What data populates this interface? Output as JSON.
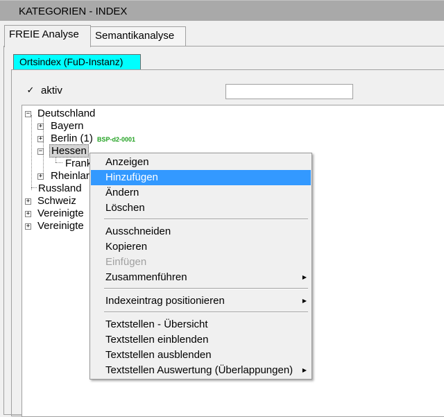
{
  "window": {
    "title": "KATEGORIEN - INDEX"
  },
  "tabs": [
    {
      "label": "FREIE Analyse",
      "active": true
    },
    {
      "label": "Semantikanalyse",
      "active": false
    }
  ],
  "subtab": {
    "label": "Ortsindex (FuD-Instanz)"
  },
  "filter": {
    "active_label": "aktiv",
    "checked": true,
    "checkmark": "✓",
    "input_value": ""
  },
  "tree": {
    "root": "Deutschland",
    "children": [
      {
        "label": "Bayern"
      },
      {
        "label": "Berlin (1)",
        "code": "BSP-d2-0001",
        "code_color": "#21a121"
      },
      {
        "label": "Hessen",
        "selected": true,
        "child": "Frank"
      },
      {
        "label": "Rheinlar"
      }
    ],
    "roots": [
      {
        "label": "Russland"
      },
      {
        "label": "Schweiz"
      },
      {
        "label": "Vereinigte"
      },
      {
        "label": "Vereinigte"
      }
    ]
  },
  "context_menu": {
    "highlight_color": "#3399ff",
    "groups": [
      [
        "Anzeigen",
        "Hinzufügen",
        "Ändern",
        "Löschen"
      ],
      [
        "Ausschneiden",
        "Kopieren",
        "Einfügen",
        "Zusammenführen"
      ],
      [
        "Indexeintrag positionieren"
      ],
      [
        "Textstellen - Übersicht",
        "Textstellen einblenden",
        "Textstellen ausblenden",
        "Textstellen Auswertung (Überlappungen)"
      ]
    ],
    "highlighted": "Hinzufügen",
    "disabled": [
      "Einfügen"
    ],
    "submenu": [
      "Zusammenführen",
      "Indexeintrag positionieren",
      "Textstellen Auswertung (Überlappungen)"
    ],
    "submenu_arrow": "▶"
  }
}
